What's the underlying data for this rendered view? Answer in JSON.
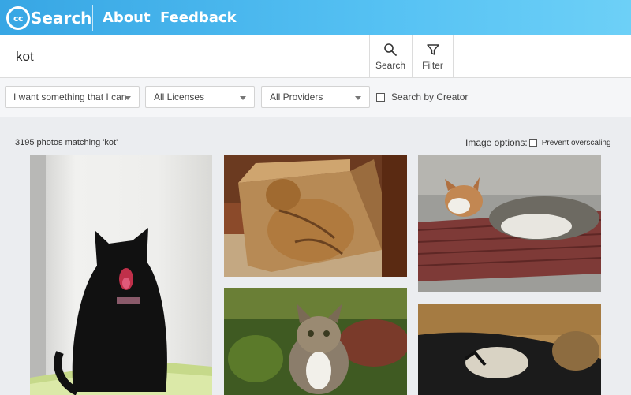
{
  "header": {
    "logo_cc": "cc",
    "logo_text": "Search",
    "nav": [
      "About",
      "Feedback"
    ]
  },
  "search": {
    "query": "kot",
    "search_button_label": "Search",
    "filter_button_label": "Filter"
  },
  "filters": {
    "use_select": "I want something that I can",
    "license_select": "All Licenses",
    "provider_select": "All Providers",
    "search_by_creator_label": "Search by Creator"
  },
  "results": {
    "count_text": "3195 photos matching 'kot'",
    "image_options_label": "Image options:",
    "prevent_overscaling_label": "Prevent overscaling"
  },
  "photos": [
    {
      "subject": "black cat yawning"
    },
    {
      "subject": "tabby cat in cardboard box"
    },
    {
      "subject": "calico cat lying on chair"
    },
    {
      "subject": "tabby kitten on grass"
    },
    {
      "subject": "blurred black and white cat"
    }
  ],
  "colors": {
    "header_gradient_start": "#37a6e4",
    "header_gradient_end": "#6dd0f7",
    "page_background": "#ebedf0"
  },
  "icons": [
    "search-icon",
    "filter-icon",
    "chevron-down-icon",
    "checkbox-icon"
  ]
}
